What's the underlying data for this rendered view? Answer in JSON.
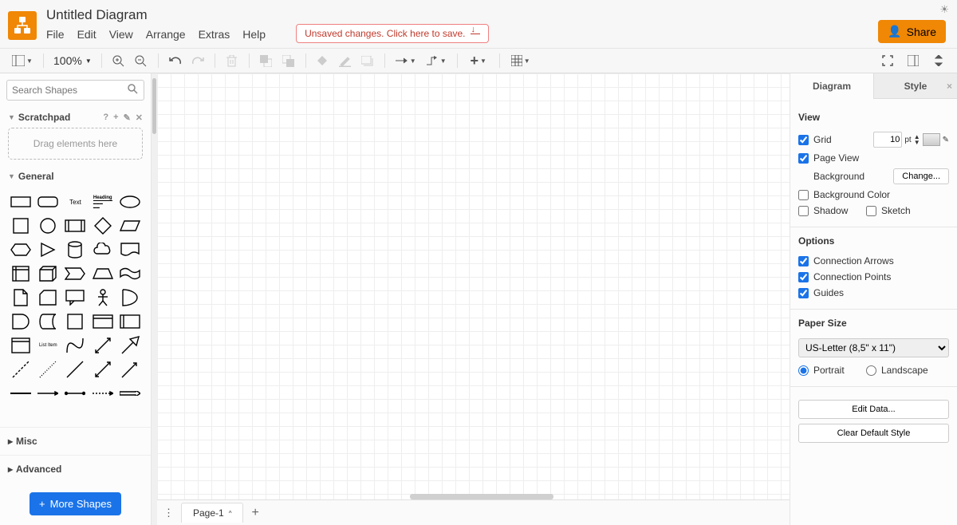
{
  "title": "Untitled Diagram",
  "menu": {
    "file": "File",
    "edit": "Edit",
    "view": "View",
    "arrange": "Arrange",
    "extras": "Extras",
    "help": "Help"
  },
  "unsaved_message": "Unsaved changes. Click here to save.",
  "share_label": "Share",
  "toolbar": {
    "zoom": "100%"
  },
  "sidebar": {
    "search_placeholder": "Search Shapes",
    "scratchpad_label": "Scratchpad",
    "scratchpad_help": "?",
    "scratchpad_drop": "Drag elements here",
    "general_label": "General",
    "misc_label": "Misc",
    "advanced_label": "Advanced",
    "more_shapes": "More Shapes"
  },
  "pages": {
    "page1": "Page-1"
  },
  "panel": {
    "tabs": {
      "diagram": "Diagram",
      "style": "Style"
    },
    "view_h": "View",
    "grid": "Grid",
    "grid_value": "10",
    "grid_unit": "pt",
    "page_view": "Page View",
    "background": "Background",
    "change": "Change...",
    "bg_color": "Background Color",
    "shadow": "Shadow",
    "sketch": "Sketch",
    "options_h": "Options",
    "conn_arrows": "Connection Arrows",
    "conn_points": "Connection Points",
    "guides": "Guides",
    "paper_h": "Paper Size",
    "paper_value": "US-Letter (8,5\" x 11\")",
    "portrait": "Portrait",
    "landscape": "Landscape",
    "edit_data": "Edit Data...",
    "clear_style": "Clear Default Style"
  }
}
